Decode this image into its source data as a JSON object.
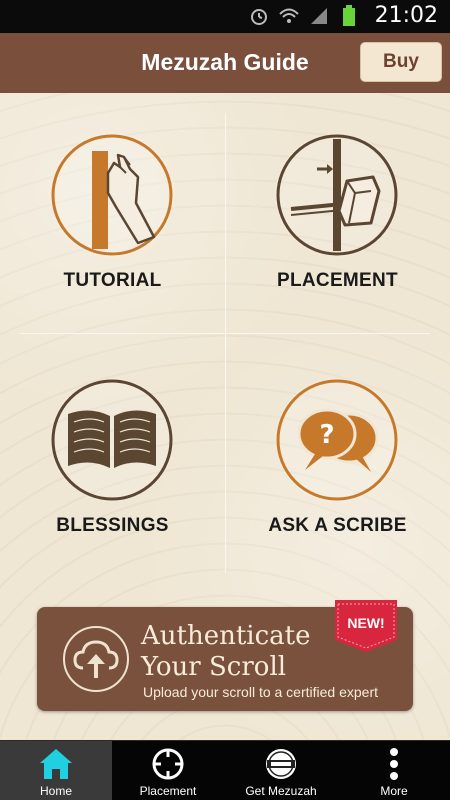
{
  "status_bar": {
    "time": "21:02",
    "icons": [
      "alarm-icon",
      "wifi-icon",
      "signal-icon",
      "battery-icon"
    ]
  },
  "header": {
    "title": "Mezuzah Guide",
    "buy_label": "Buy"
  },
  "tiles": [
    {
      "label": "TUTORIAL",
      "icon": "hand-affixing-icon"
    },
    {
      "label": "PLACEMENT",
      "icon": "doorpost-mezuzah-icon"
    },
    {
      "label": "BLESSINGS",
      "icon": "open-book-icon"
    },
    {
      "label": "ASK A SCRIBE",
      "icon": "question-chat-icon"
    }
  ],
  "banner": {
    "title_line1": "Authenticate",
    "title_line2": "Your Scroll",
    "subtitle": "Upload your scroll to a certified expert",
    "badge": "NEW!",
    "icon": "cloud-upload-icon"
  },
  "tabbar": {
    "tabs": [
      {
        "label": "Home",
        "icon": "home-icon",
        "active": true
      },
      {
        "label": "Placement",
        "icon": "target-icon",
        "active": false
      },
      {
        "label": "Get Mezuzah",
        "icon": "mezuzah-seal-icon",
        "active": false
      },
      {
        "label": "More",
        "icon": "more-vertical-icon",
        "active": false
      }
    ]
  },
  "colors": {
    "header_bg": "#7a4f3b",
    "content_bg": "#efe6d3",
    "accent_orange": "#c7792b",
    "icon_brown": "#5b4632",
    "tab_active": "#3a3a3a",
    "home_icon": "#20d0e0",
    "badge_red": "#d7263d"
  }
}
